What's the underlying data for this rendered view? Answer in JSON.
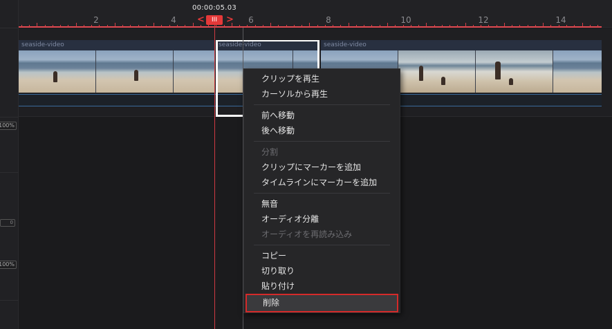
{
  "playhead": {
    "timecode": "00:00:05.03",
    "handle_glyph": "III",
    "left_chevron": "<",
    "right_chevron": ">"
  },
  "ruler": {
    "labels": [
      "2",
      "4",
      "6",
      "8",
      "10",
      "12",
      "14"
    ]
  },
  "gutter": {
    "zoom_top": "100%",
    "zoom_bottom": "100%",
    "spin_value": "0"
  },
  "track": {
    "clips": [
      {
        "label": "seaside-video"
      },
      {
        "label": "seaside-video"
      },
      {
        "label": "seaside-video"
      }
    ]
  },
  "context_menu": {
    "groups": [
      [
        {
          "label": "クリップを再生",
          "enabled": true
        },
        {
          "label": "カーソルから再生",
          "enabled": true
        }
      ],
      [
        {
          "label": "前へ移動",
          "enabled": true
        },
        {
          "label": "後へ移動",
          "enabled": true
        }
      ],
      [
        {
          "label": "分割",
          "enabled": false
        },
        {
          "label": "クリップにマーカーを追加",
          "enabled": true
        },
        {
          "label": "タイムラインにマーカーを追加",
          "enabled": true
        }
      ],
      [
        {
          "label": "無音",
          "enabled": true
        },
        {
          "label": "オーディオ分離",
          "enabled": true
        },
        {
          "label": "オーディオを再読み込み",
          "enabled": false
        }
      ],
      [
        {
          "label": "コピー",
          "enabled": true
        },
        {
          "label": "切り取り",
          "enabled": true
        },
        {
          "label": "貼り付け",
          "enabled": true
        },
        {
          "label": "削除",
          "enabled": true,
          "highlighted": true
        }
      ]
    ]
  },
  "colors": {
    "playhead": "#e53939",
    "highlight_border": "#d42a2a",
    "audio_lane": "#3a6b9c"
  }
}
